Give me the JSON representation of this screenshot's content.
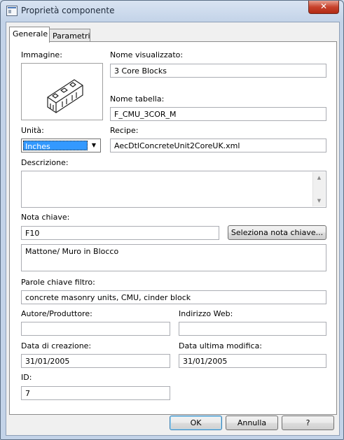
{
  "window": {
    "title": "Proprietà componente",
    "close_glyph": "✕"
  },
  "tabs": [
    {
      "label": "Generale",
      "active": true
    },
    {
      "label": "Parametri",
      "active": false
    }
  ],
  "general": {
    "image_label": "Immagine:",
    "display_name_label": "Nome visualizzato:",
    "display_name_value": "3 Core Blocks",
    "table_name_label": "Nome tabella:",
    "table_name_value": "F_CMU_3COR_M",
    "units_label": "Unità:",
    "units_value": "Inches",
    "recipe_label": "Recipe:",
    "recipe_value": "AecDtlConcreteUnit2CoreUK.xml",
    "description_label": "Descrizione:",
    "description_value": "",
    "keynote_label": "Nota chiave:",
    "keynote_value": "F10",
    "select_keynote_button": "Seleziona nota chiave...",
    "keynote_description": "Mattone/ Muro in Blocco",
    "filter_keywords_label": "Parole chiave filtro:",
    "filter_keywords_value": "concrete masonry units, CMU, cinder block",
    "author_label": "Autore/Produttore:",
    "author_value": "",
    "web_address_label": "Indirizzo Web:",
    "web_address_value": "",
    "created_label": "Data di creazione:",
    "created_value": "31/01/2005",
    "modified_label": "Data ultima modifica:",
    "modified_value": "31/01/2005",
    "id_label": "ID:",
    "id_value": "7"
  },
  "footer": {
    "ok": "OK",
    "cancel": "Annulla",
    "help": "?"
  },
  "colors": {
    "selection": "#3399ff",
    "close_button": "#c7422c",
    "default_button_border": "#3c7fb1"
  }
}
